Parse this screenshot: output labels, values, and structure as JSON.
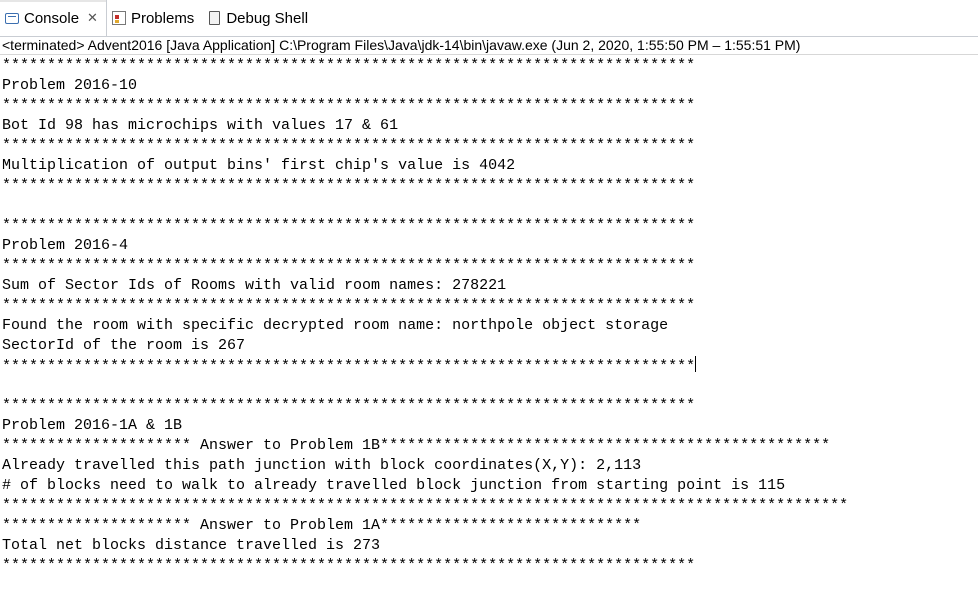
{
  "tabs": [
    {
      "label": "Console",
      "icon": "console-icon",
      "active": true,
      "closable": true
    },
    {
      "label": "Problems",
      "icon": "problems-icon",
      "active": false
    },
    {
      "label": "Debug Shell",
      "icon": "debug-shell-icon",
      "active": false
    }
  ],
  "status": "<terminated> Advent2016 [Java Application] C:\\Program Files\\Java\\jdk-14\\bin\\javaw.exe  (Jun 2, 2020, 1:55:50 PM – 1:55:51 PM)",
  "console_lines": [
    "*****************************************************************************",
    "Problem 2016-10",
    "*****************************************************************************",
    "Bot Id 98 has microchips with values 17 & 61",
    "*****************************************************************************",
    "Multiplication of output bins' first chip's value is 4042",
    "*****************************************************************************",
    "",
    "*****************************************************************************",
    "Problem 2016-4",
    "*****************************************************************************",
    "Sum of Sector Ids of Rooms with valid room names: 278221",
    "*****************************************************************************",
    "Found the room with specific decrypted room name: northpole object storage",
    "SectorId of the room is 267",
    "*****************************************************************************",
    "",
    "*****************************************************************************",
    "Problem 2016-1A & 1B",
    "********************* Answer to Problem 1B**************************************************",
    "Already travelled this path junction with block coordinates(X,Y): 2,113",
    "# of blocks need to walk to already travelled block junction from starting point is 115",
    "**********************************************************************************************",
    "********************* Answer to Problem 1A*****************************",
    "Total net blocks distance travelled is 273",
    "*****************************************************************************"
  ]
}
